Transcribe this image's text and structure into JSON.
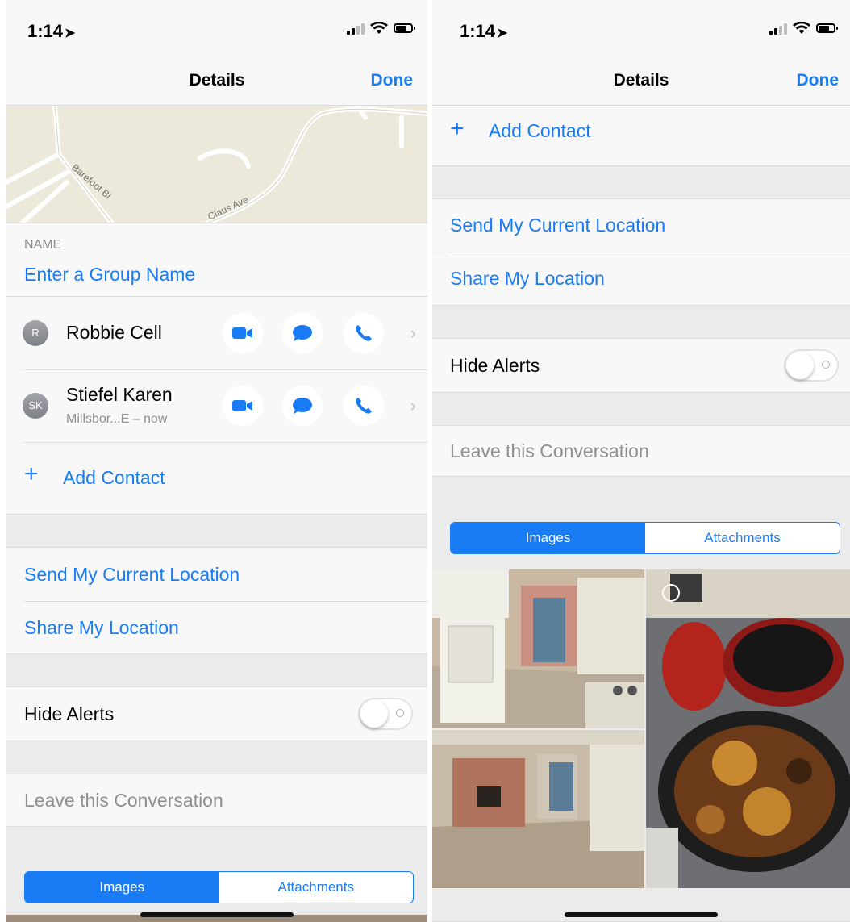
{
  "status": {
    "time": "1:14"
  },
  "nav": {
    "title": "Details",
    "done": "Done"
  },
  "map": {
    "street_1": "Barefoot Bl",
    "street_2": "Claus Ave"
  },
  "name_section": {
    "label": "NAME",
    "placeholder": "Enter a Group Name"
  },
  "contacts": [
    {
      "initials": "R",
      "name": "Robbie Cell",
      "subtitle": ""
    },
    {
      "initials": "SK",
      "name": "Stiefel Karen",
      "subtitle": "Millsbor...E – now"
    }
  ],
  "add_contact": {
    "plus": "+",
    "label": "Add Contact"
  },
  "location": {
    "send_current": "Send My Current Location",
    "share": "Share My Location"
  },
  "alerts": {
    "label": "Hide Alerts",
    "enabled": false
  },
  "leave": {
    "label": "Leave this Conversation"
  },
  "media_tabs": {
    "images": "Images",
    "attachments": "Attachments",
    "selected": "Images"
  },
  "colors": {
    "accent": "#1a7cf5",
    "background": "#f2f2f2"
  },
  "icons": {
    "location_arrow": "location-arrow-icon",
    "signal": "signal-icon",
    "wifi": "wifi-icon",
    "battery": "battery-icon",
    "video": "video-icon",
    "message": "message-icon",
    "phone": "phone-icon",
    "chevron": "chevron-right-icon"
  }
}
